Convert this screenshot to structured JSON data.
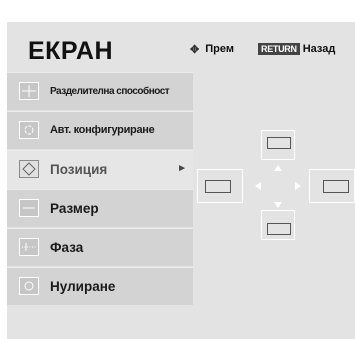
{
  "title": "ЕКРАН",
  "hints": {
    "move_label": "Прем",
    "return_key": "RETURN",
    "return_label": "Назад"
  },
  "menu": {
    "items": [
      {
        "label": "Разделителна способност",
        "icon": "resolution-icon"
      },
      {
        "label": "Авт. конфигуриране",
        "icon": "auto-config-icon"
      },
      {
        "label": "Позиция",
        "icon": "position-icon",
        "selected": true
      },
      {
        "label": "Размер",
        "icon": "size-icon"
      },
      {
        "label": "Фаза",
        "icon": "phase-icon"
      },
      {
        "label": "Нулиране",
        "icon": "reset-icon"
      }
    ]
  },
  "colors": {
    "panel": "#e3e3e3",
    "item": "#d3d3d3",
    "selected_item": "#e6e6e6",
    "text": "#1a1a1a"
  }
}
